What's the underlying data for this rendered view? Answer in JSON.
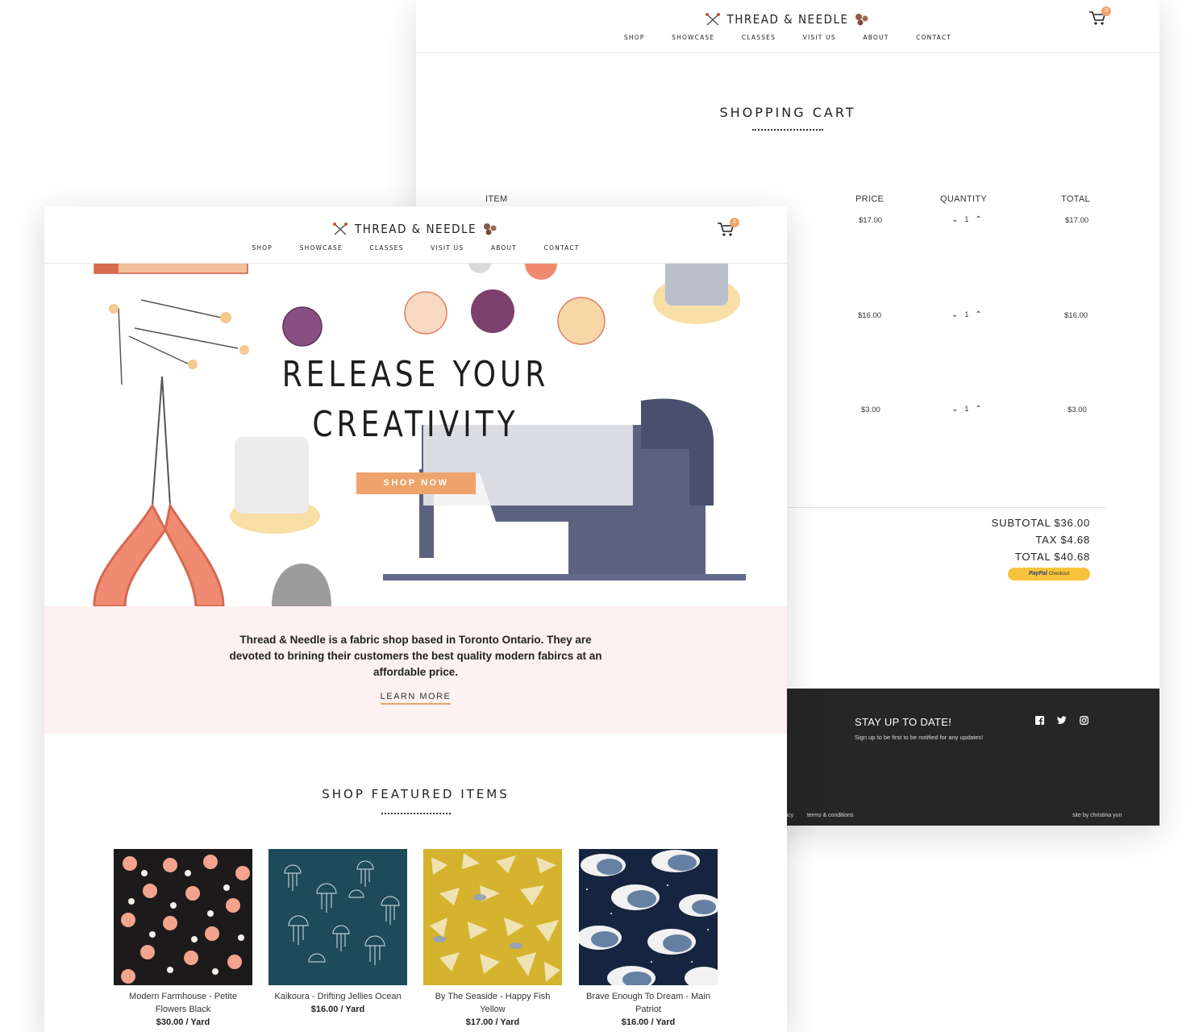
{
  "brand": {
    "name": "THREAD & NEEDLE",
    "accent": "#eea36b",
    "nav": [
      "SHOP",
      "SHOWCASE",
      "CLASSES",
      "VISIT US",
      "ABOUT",
      "CONTACT"
    ],
    "cart_count": "3"
  },
  "cart_page": {
    "title": "SHOPPING CART",
    "columns": {
      "item": "ITEM",
      "price": "PRICE",
      "quantity": "QUANTITY",
      "total": "TOTAL"
    },
    "rows": [
      {
        "price": "$17.00",
        "qty": "1",
        "total": "$17.00"
      },
      {
        "price": "$16.00",
        "qty": "1",
        "total": "$16.00"
      },
      {
        "price": "$3.00",
        "qty": "1",
        "total": "$3.00"
      }
    ],
    "subtotal": "SUBTOTAL $36.00",
    "tax": "TAX $4.68",
    "total": "TOTAL $40.68",
    "paypal_brand": "PayPal",
    "paypal_label": "Checkout",
    "footer": {
      "title": "STAY UP TO DATE!",
      "subtitle": "Sign up to be first to be notified for any updates!",
      "link_partial": "licy",
      "terms": "terms & conditions",
      "credit": "site by christina yun"
    }
  },
  "home_page": {
    "hero_line1": "RELEASE YOUR",
    "hero_line2": "CREATIVITY",
    "hero_cta": "SHOP NOW",
    "about_text": "Thread & Needle is a fabric shop based in Toronto Ontario. They are devoted to brining their customers the best quality modern fabircs at an affordable price.",
    "learn_more": "LEARN MORE",
    "featured_title": "SHOP FEATURED ITEMS",
    "products": [
      {
        "name": "Modern Farmhouse - Petite Flowers Black",
        "price": "$30.00 / Yard"
      },
      {
        "name": "Kaikoura - Drifting Jellies Ocean",
        "price": "$16.00 / Yard"
      },
      {
        "name": "By The Seaside - Happy Fish Yellow",
        "price": "$17.00 / Yard"
      },
      {
        "name": "Brave Enough To Dream - Main Patriot",
        "price": "$16.00 / Yard"
      }
    ]
  }
}
